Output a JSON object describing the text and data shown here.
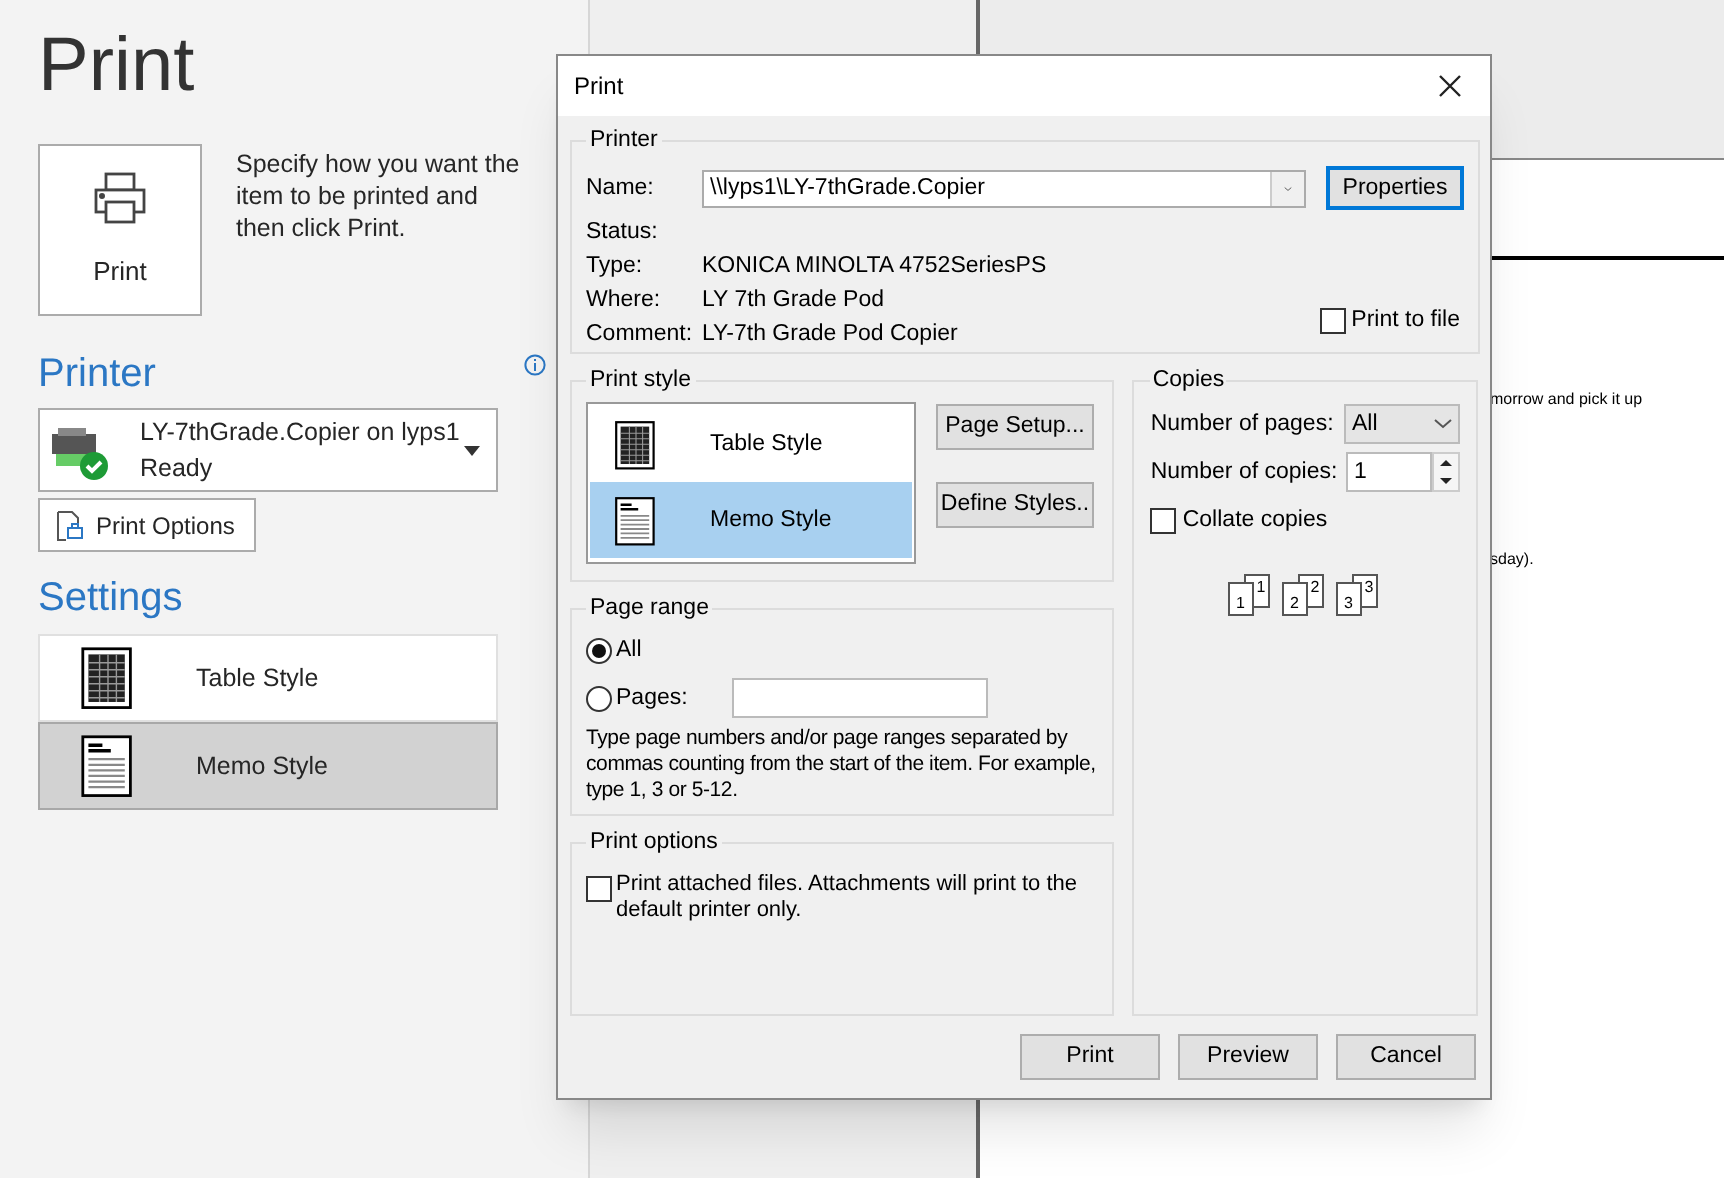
{
  "backstage": {
    "title": "Print",
    "print_button": {
      "label": "Print"
    },
    "description": "Specify how you want the item to be printed and then click Print.",
    "printer_heading": "Printer",
    "printer": {
      "name": "LY-7thGrade.Copier on lyps1",
      "status": "Ready"
    },
    "print_options_button": "Print Options",
    "settings_heading": "Settings",
    "styles": [
      {
        "kind": "table",
        "label": "Table Style",
        "selected": false
      },
      {
        "kind": "memo",
        "label": "Memo Style",
        "selected": true
      }
    ]
  },
  "preview": {
    "lines": [
      "morrow and pick it up",
      "sday)."
    ]
  },
  "dialog": {
    "title": "Print",
    "printer": {
      "legend": "Printer",
      "name_label": "Name:",
      "name_value": "\\\\lyps1\\LY-7thGrade.Copier",
      "properties_button": "Properties",
      "fields": [
        {
          "label": "Status:"
        },
        {
          "label": "Type:",
          "value": "KONICA MINOLTA 4752SeriesPS"
        },
        {
          "label": "Where:",
          "value": "LY 7th Grade Pod"
        },
        {
          "label": "Comment:",
          "value": "LY-7th Grade Pod Copier"
        }
      ],
      "print_to_file": {
        "label": "Print to file",
        "checked": false
      }
    },
    "print_style": {
      "legend": "Print style",
      "styles": [
        {
          "kind": "table",
          "label": "Table Style",
          "selected": false
        },
        {
          "kind": "memo",
          "label": "Memo Style",
          "selected": true
        }
      ],
      "buttons": [
        "Page Setup...",
        "Define Styles.."
      ]
    },
    "copies": {
      "legend": "Copies",
      "number_of_pages": {
        "label": "Number of pages:",
        "value": "All"
      },
      "number_of_copies": {
        "label": "Number of copies:",
        "value": "1"
      },
      "collate": {
        "label": "Collate copies",
        "checked": false
      },
      "pages": [
        "1",
        "1",
        "2",
        "2",
        "3",
        "3"
      ]
    },
    "page_range": {
      "legend": "Page range",
      "options": [
        {
          "label": "All",
          "selected": true
        },
        {
          "label": "Pages:",
          "selected": false
        }
      ],
      "help": "Type page numbers and/or page ranges separated by commas counting from the start of the item.  For example, type 1, 3 or 5-12."
    },
    "print_options": {
      "legend": "Print options",
      "attached_files": {
        "label": "Print attached files.  Attachments will print to the default printer only.",
        "checked": false
      }
    },
    "buttons": [
      "Print",
      "Preview",
      "Cancel"
    ]
  }
}
